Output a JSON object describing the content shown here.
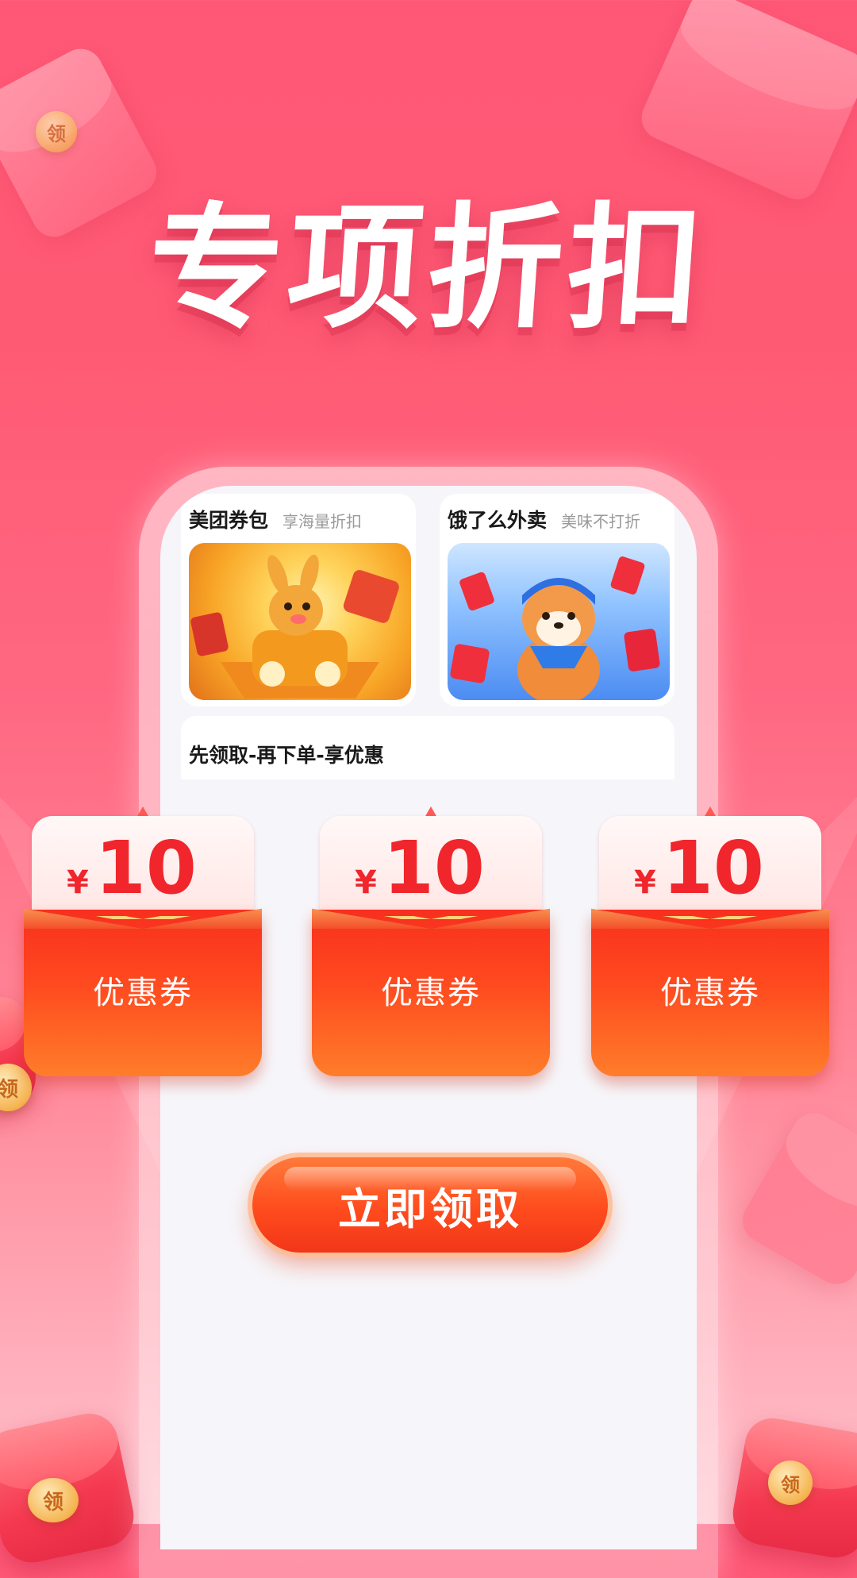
{
  "hero": {
    "title": "专项折扣"
  },
  "cards": [
    {
      "title": "美团券包",
      "subtitle": "享海量折扣",
      "image": "meituan-kangaroo-mascot-image"
    },
    {
      "title": "饿了么外卖",
      "subtitle": "美味不打折",
      "image": "eleme-shiba-mascot-image"
    }
  ],
  "notice": {
    "text": "先领取-再下单-享优惠"
  },
  "coupons": [
    {
      "currency": "¥",
      "amount": "10",
      "label": "优惠券"
    },
    {
      "currency": "¥",
      "amount": "10",
      "label": "优惠券"
    },
    {
      "currency": "¥",
      "amount": "10",
      "label": "优惠券"
    }
  ],
  "cta": {
    "label": "立即领取"
  },
  "decor": {
    "coin_text": "领"
  },
  "colors": {
    "background_top": "#ff5877",
    "background_bottom": "#ffc4ce",
    "coupon_red": "#f82f1f",
    "coupon_amount": "#f0262c",
    "button_orange": "#ff4b1d"
  }
}
